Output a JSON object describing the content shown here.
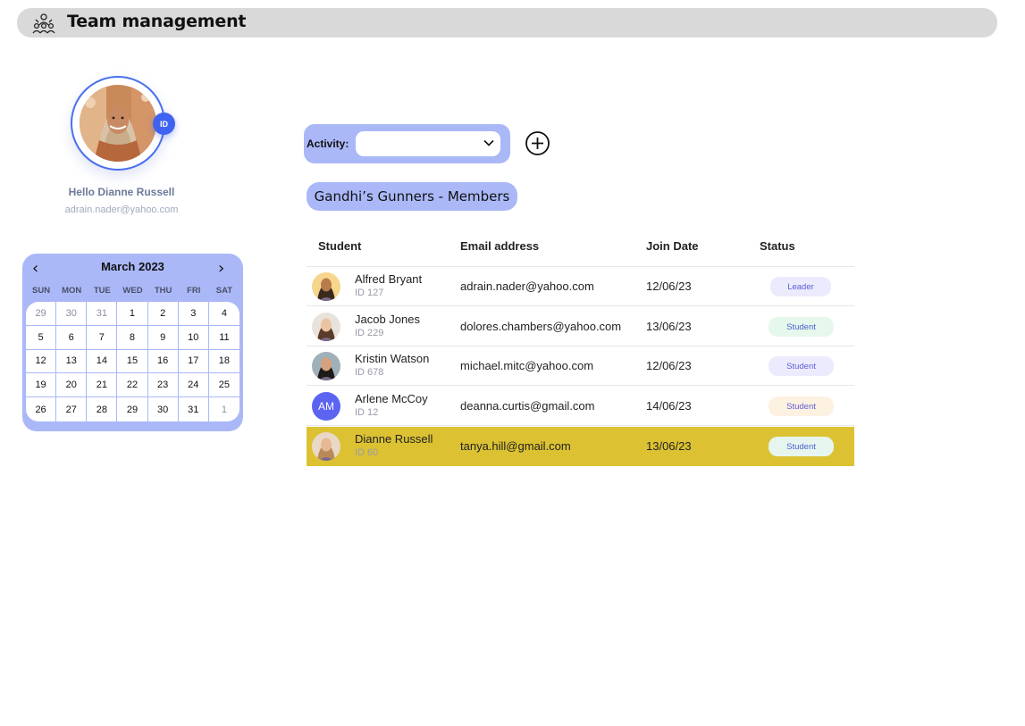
{
  "header": {
    "title": "Team management",
    "icon": "team-icon"
  },
  "profile": {
    "badge": "ID",
    "greeting": "Hello Dianne Russell",
    "email": "adrain.nader@yahoo.com"
  },
  "calendar": {
    "month": "March 2023",
    "prev_icon": "chevron-left-icon",
    "next_icon": "chevron-right-icon",
    "weekdays": [
      "SUN",
      "MON",
      "TUE",
      "WED",
      "THU",
      "FRI",
      "SAT"
    ],
    "days": [
      {
        "n": "29",
        "muted": true
      },
      {
        "n": "30",
        "muted": true
      },
      {
        "n": "31",
        "muted": true
      },
      {
        "n": "1"
      },
      {
        "n": "2"
      },
      {
        "n": "3"
      },
      {
        "n": "4"
      },
      {
        "n": "5"
      },
      {
        "n": "6"
      },
      {
        "n": "7"
      },
      {
        "n": "8"
      },
      {
        "n": "9"
      },
      {
        "n": "10"
      },
      {
        "n": "11"
      },
      {
        "n": "12"
      },
      {
        "n": "13"
      },
      {
        "n": "14"
      },
      {
        "n": "15"
      },
      {
        "n": "16"
      },
      {
        "n": "17"
      },
      {
        "n": "18"
      },
      {
        "n": "19"
      },
      {
        "n": "20"
      },
      {
        "n": "21"
      },
      {
        "n": "22"
      },
      {
        "n": "23"
      },
      {
        "n": "24"
      },
      {
        "n": "25"
      },
      {
        "n": "26"
      },
      {
        "n": "27"
      },
      {
        "n": "28"
      },
      {
        "n": "29"
      },
      {
        "n": "30"
      },
      {
        "n": "31"
      },
      {
        "n": "1",
        "muted": true
      }
    ]
  },
  "activity": {
    "label": "Activity:",
    "value": "",
    "add_icon": "plus-circle-icon"
  },
  "team": {
    "title": "Gandhi’s Gunners - Members"
  },
  "table": {
    "headers": {
      "student": "Student",
      "email": "Email address",
      "join": "Join Date",
      "status": "Status"
    },
    "rows": [
      {
        "name": "Alfred Bryant",
        "id": "ID 127",
        "email": "adrain.nader@yahoo.com",
        "date": "12/06/23",
        "status": "Leader",
        "badge_bg": "#ecebfd",
        "badge_fg": "#5b5fd6",
        "avatar_bg": "#f6d58c",
        "skin": "#b97a4c",
        "hair": "#3a2a1e",
        "highlight": false
      },
      {
        "name": "Jacob Jones",
        "id": "ID 229",
        "email": "dolores.chambers@yahoo.com",
        "date": "13/06/23",
        "status": "Student",
        "badge_bg": "#e6f7ec",
        "badge_fg": "#4a62cf",
        "avatar_bg": "#e8e2dc",
        "skin": "#e9c3a2",
        "hair": "#5a3a28",
        "highlight": false
      },
      {
        "name": "Kristin Watson",
        "id": "ID 678",
        "email": "michael.mitc@yahoo.com",
        "date": "12/06/23",
        "status": "Student",
        "badge_bg": "#ecebfd",
        "badge_fg": "#5b5fd6",
        "avatar_bg": "#9fb0b8",
        "skin": "#d6a07c",
        "hair": "#1e1a18",
        "highlight": false
      },
      {
        "name": "Arlene McCoy",
        "id": "ID 12",
        "email": "deanna.curtis@gmail.com",
        "date": "14/06/23",
        "status": "Student",
        "initials": "AM",
        "badge_bg": "#fdf1e2",
        "badge_fg": "#5b5fd6",
        "highlight": false
      },
      {
        "name": "Dianne Russell",
        "id": "ID 60",
        "email": "tanya.hill@gmail.com",
        "date": "13/06/23",
        "status": "Student",
        "badge_bg": "#e6f5ee",
        "badge_fg": "#4a62cf",
        "avatar_bg": "#e9d8c6",
        "skin": "#e6b894",
        "hair": "#b88a5a",
        "highlight": true
      }
    ]
  },
  "colors": {
    "accent": "#aab8f8",
    "highlight": "#dcc232",
    "badge_blue": "#3f63f0"
  }
}
